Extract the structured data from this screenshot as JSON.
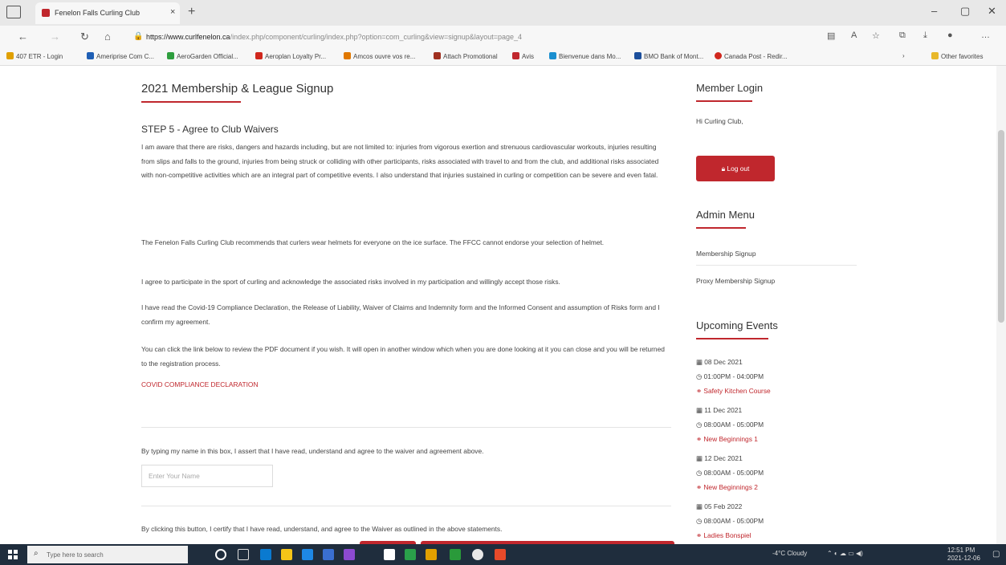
{
  "browser": {
    "tab_title": "Fenelon Falls Curling Club",
    "tab_close": "×",
    "new_tab": "+",
    "url_host": "https://www.curlfenelon.ca",
    "url_path": "/index.php/component/curling/index.php?option=com_curling&view=signup&layout=page_4",
    "window_controls": {
      "minimize": "–",
      "maximize": "▢",
      "close": "✕"
    },
    "nav": {
      "back": "←",
      "forward": "→",
      "refresh": "↻",
      "home": "⌂"
    },
    "bookmarks": [
      "407 ETR - Login",
      "Ameriprise Com C...",
      "AeroGarden Official...",
      "Aeroplan Loyalty Pr...",
      "Amcos ouvre vos re...",
      "Attach Promotional",
      "Avis",
      "Bienvenue dans Mo...",
      "BMO Bank of Mont...",
      "Canada Post - Redir..."
    ],
    "other_favorites": "Other favorites",
    "bookmark_colors": [
      "#e0a000",
      "#1f5fb5",
      "#2e9e3e",
      "#d0271d",
      "#e07800",
      "#a03020",
      "#c0272d",
      "#1a8fd0",
      "#1c4f9c",
      "#d0271d"
    ]
  },
  "main": {
    "title": "2021 Membership & League Signup",
    "step_title": "STEP 5 - Agree to Club Waivers",
    "paragraphs": [
      "I am aware that there are risks, dangers and hazards including, but are not limited to: injuries from vigorous exertion and strenuous cardiovascular workouts, injuries resulting from slips and falls to the ground, injuries from being struck or colliding with other participants, risks associated with travel to and from the club, and additional risks associated with non-competitive activities which are an integral part of competitive events. I also understand that injuries sustained in curling or competition can be severe and even fatal.",
      "The Fenelon Falls Curling Club recommends that curlers wear helmets for everyone on the ice surface.  The FFCC cannot endorse your selection of helmet.",
      "I agree to participate in the sport of curling and acknowledge the associated risks involved in my participation and willingly accept those risks.",
      "I have read the Covid-19 Compliance Declaration, the Release of Liability, Waiver of Claims and Indemnity form and the Informed Consent and assumption of Risks form and I confirm my agreement.",
      "You can click the link below to review the PDF document if you wish. It will open in another window which when you are done looking at it you can close and you will be returned to the registration process."
    ],
    "covid_link": "COVID COMPLIANCE DECLARATION",
    "typing_statement": "By typing my name in this box, I assert that I have read, understand and agree to the waiver and agreement above.",
    "name_placeholder": "Enter Your Name",
    "certify_statement": "By clicking this button, I certify that I have read, understand, and agree to the Waiver as outlined in the above statements.",
    "accent_color": "#c0272d"
  },
  "sidebar": {
    "login_title": "Member Login",
    "greeting": "Hi Curling Club,",
    "logout_label": "Log out",
    "admin_title": "Admin Menu",
    "admin_items": [
      "Membership Signup",
      "Proxy Membership Signup"
    ],
    "events_title": "Upcoming Events",
    "events": [
      {
        "date": "08 Dec 2021",
        "time": "01:00PM - 04:00PM",
        "name": "Safety Kitchen Course"
      },
      {
        "date": "11 Dec 2021",
        "time": "08:00AM - 05:00PM",
        "name": "New Beginnings 1"
      },
      {
        "date": "12 Dec 2021",
        "time": "08:00AM - 05:00PM",
        "name": "New Beginnings 2"
      },
      {
        "date": "05 Feb 2022",
        "time": "08:00AM - 05:00PM",
        "name": "Ladies Bonspiel"
      }
    ]
  },
  "taskbar": {
    "search_placeholder": "Type here to search",
    "weather": "-4°C Cloudy",
    "time": "12:51 PM",
    "date": "2021-12-06",
    "app_colors": [
      "#ffffff",
      "#3aa0e8",
      "#0a7ad0",
      "#f5c518",
      "#1e88e5",
      "#3a6fd0",
      "#8c4ad0",
      "#2aa04a",
      "#ffffff",
      "#e0a000",
      "#2a9a3a",
      "#e8e8e8",
      "#e84a2a"
    ]
  }
}
